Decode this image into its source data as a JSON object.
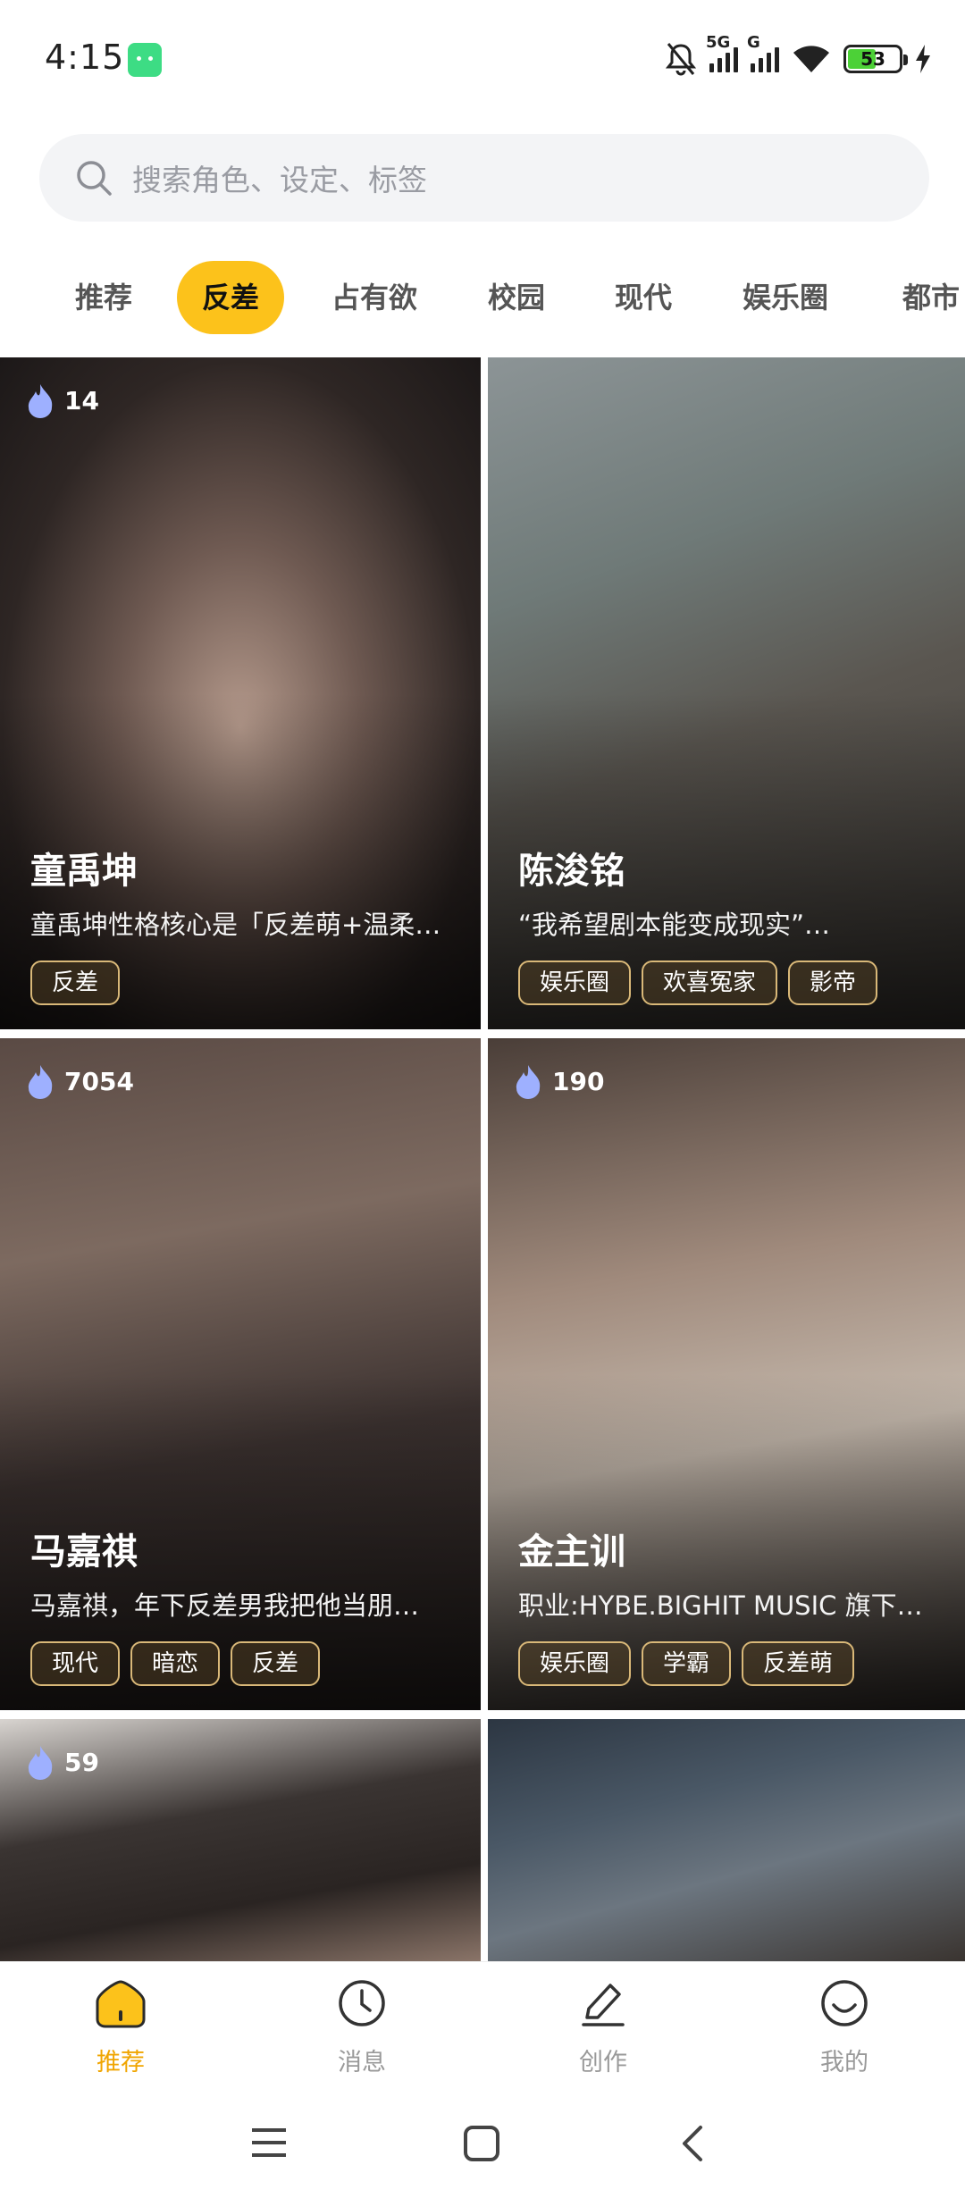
{
  "status_bar": {
    "time": "4:15",
    "network_1": "5G",
    "network_2": "G",
    "battery": "53",
    "icons": [
      "android-icon",
      "mute-bell-icon",
      "signal-icon",
      "wifi-icon",
      "battery-icon",
      "charging-icon"
    ]
  },
  "search": {
    "placeholder": "搜索角色、设定、标签",
    "icon": "search-icon"
  },
  "tabs": [
    {
      "label": "推荐",
      "active": false
    },
    {
      "label": "反差",
      "active": true
    },
    {
      "label": "占有欲",
      "active": false
    },
    {
      "label": "校园",
      "active": false
    },
    {
      "label": "现代",
      "active": false
    },
    {
      "label": "娱乐圈",
      "active": false
    },
    {
      "label": "都市",
      "active": false
    }
  ],
  "cards": [
    {
      "hot": "14",
      "name": "童禹坤",
      "desc": "童禹坤性格核心是「反差萌+温柔…",
      "tags": [
        "反差"
      ]
    },
    {
      "hot": "",
      "name": "陈浚铭",
      "desc": "“我希望剧本能变成现实”…",
      "tags": [
        "娱乐圈",
        "欢喜冤家",
        "影帝"
      ]
    },
    {
      "hot": "7054",
      "name": "马嘉祺",
      "desc": "马嘉祺，年下反差男我把他当朋…",
      "tags": [
        "现代",
        "暗恋",
        "反差"
      ]
    },
    {
      "hot": "190",
      "name": "金主训",
      "desc": "职业:HYBE.BIGHIT MUSIC 旗下…",
      "tags": [
        "娱乐圈",
        "学霸",
        "反差萌"
      ]
    },
    {
      "hot": "59",
      "name": "",
      "desc": "",
      "tags": []
    },
    {
      "hot": "",
      "name": "",
      "desc": "",
      "tags": []
    }
  ],
  "bottom_nav": [
    {
      "label": "推荐",
      "icon": "home-icon",
      "active": true
    },
    {
      "label": "消息",
      "icon": "clock-icon",
      "active": false
    },
    {
      "label": "创作",
      "icon": "pen-icon",
      "active": false
    },
    {
      "label": "我的",
      "icon": "smile-icon",
      "active": false
    }
  ],
  "colors": {
    "accent": "#fcc21b",
    "accent_text": "#f0a500",
    "hot_flame": "#8a9cff"
  }
}
